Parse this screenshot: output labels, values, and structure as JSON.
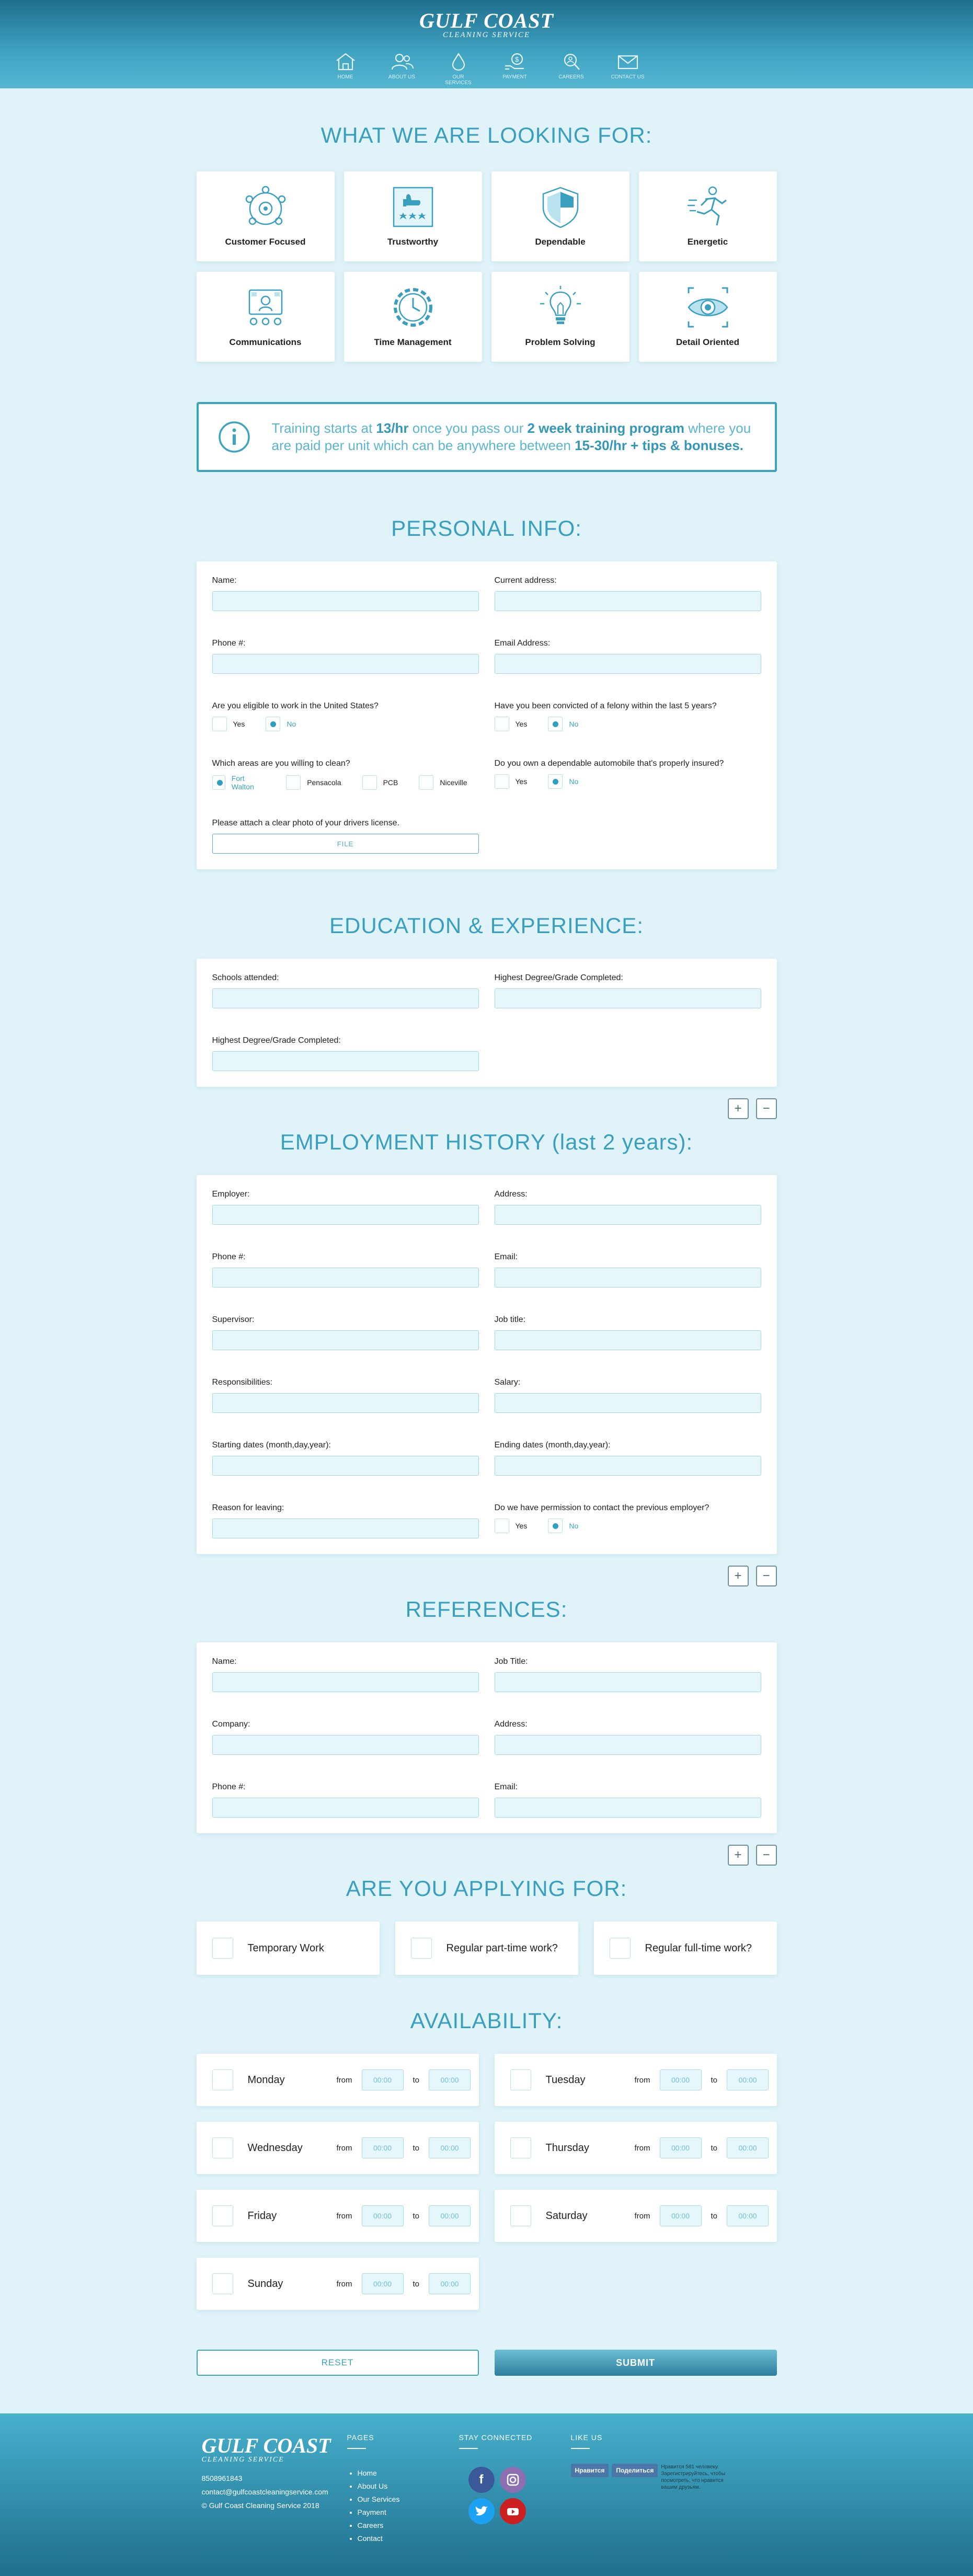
{
  "header": {
    "logo_main": "GULF COAST",
    "logo_sub": "CLEANING SERVICE",
    "nav": [
      {
        "label": "HOME",
        "icon": "home-icon"
      },
      {
        "label": "ABOUT US",
        "icon": "users-icon"
      },
      {
        "label": "OUR SERVICES",
        "icon": "drop-icon"
      },
      {
        "label": "PAYMENT",
        "icon": "money-icon"
      },
      {
        "label": "CAREERS",
        "icon": "search-icon"
      },
      {
        "label": "CONTACT US",
        "icon": "mail-icon"
      }
    ]
  },
  "looking": {
    "title": "WHAT WE ARE LOOKING FOR:",
    "items": [
      {
        "label": "Customer Focused",
        "icon": "customer-focused-icon"
      },
      {
        "label": "Trustworthy",
        "icon": "trustworthy-icon"
      },
      {
        "label": "Dependable",
        "icon": "dependable-icon"
      },
      {
        "label": "Energetic",
        "icon": "energetic-icon"
      },
      {
        "label": "Communications",
        "icon": "communications-icon"
      },
      {
        "label": "Time Management",
        "icon": "time-management-icon"
      },
      {
        "label": "Problem Solving",
        "icon": "problem-solving-icon"
      },
      {
        "label": "Detail Oriented",
        "icon": "detail-oriented-icon"
      }
    ]
  },
  "training": {
    "t1": "Training starts at ",
    "b1": "13/hr",
    "t2": " once you pass our ",
    "b2": "2 week training program",
    "t3": " where you are paid per unit which can be anywhere between ",
    "b3": "15-30/hr + tips & bonuses."
  },
  "personal": {
    "title": "PERSONAL INFO:",
    "name": "Name:",
    "address": "Current address:",
    "phone": "Phone #:",
    "email": "Email Address:",
    "eligible_q": "Are you eligible to work in the United States?",
    "felony_q": "Have you been convicted of a felony within the last 5 years?",
    "areas_q": "Which areas are you willing to clean?",
    "auto_q": "Do you own a dependable automobile that's properly insured?",
    "yes": "Yes",
    "no": "No",
    "areas": [
      "Fort Walton",
      "Pensacola",
      "PCB",
      "Niceville"
    ],
    "license_q": "Please attach a clear photo of your drivers license.",
    "file": "FILE"
  },
  "education": {
    "title": "EDUCATION & EXPERIENCE:",
    "schools": "Schools attended:",
    "degree1": "Highest Degree/Grade Completed:",
    "degree2": "Highest Degree/Grade Completed:"
  },
  "employment": {
    "title": "EMPLOYMENT HISTORY (last 2 years):",
    "employer": "Employer:",
    "address": "Address:",
    "phone": "Phone #:",
    "email": "Email:",
    "supervisor": "Supervisor:",
    "job": "Job title:",
    "resp": "Responsibilities:",
    "salary": "Salary:",
    "start": "Starting dates (month,day,year):",
    "end": "Ending dates (month,day,year):",
    "reason": "Reason for leaving:",
    "permission_q": "Do we have permission to contact the previous employer?",
    "yes": "Yes",
    "no": "No"
  },
  "references": {
    "title": "REFERENCES:",
    "name": "Name:",
    "job": "Job Title:",
    "company": "Company:",
    "address": "Address:",
    "phone": "Phone #:",
    "email": "Email:"
  },
  "controls": {
    "plus": "+",
    "minus": "−"
  },
  "applying": {
    "title": "ARE YOU APPLYING FOR:",
    "options": [
      "Temporary Work",
      "Regular part-time work?",
      "Regular full-time work?"
    ]
  },
  "availability": {
    "title": "AVAILABILITY:",
    "from": "from",
    "to": "to",
    "time_placeholder": "00:00",
    "days": [
      "Monday",
      "Tuesday",
      "Wednesday",
      "Thursday",
      "Friday",
      "Saturday",
      "Sunday"
    ]
  },
  "buttons": {
    "reset": "RESET",
    "submit": "SUBMIT"
  },
  "footer": {
    "logo_main": "GULF COAST",
    "logo_sub": "CLEANING SERVICE",
    "phone": "8508961843",
    "email": "contact@gulfcoastcleaningservice.com",
    "copyright": "© Gulf Coast Cleaning Service 2018",
    "pages_title": "PAGES",
    "pages": [
      "Home",
      "About Us",
      "Our Services",
      "Payment",
      "Careers",
      "Contact"
    ],
    "stay_title": "STAY CONNECTED",
    "like_title": "LIKE US",
    "like_btn": "Нравится",
    "share_btn": "Поделиться",
    "like_text": "Нравится 581 человеку. Зарегистрируйтесь, чтобы посмотреть, что нравится вашим друзьям."
  }
}
